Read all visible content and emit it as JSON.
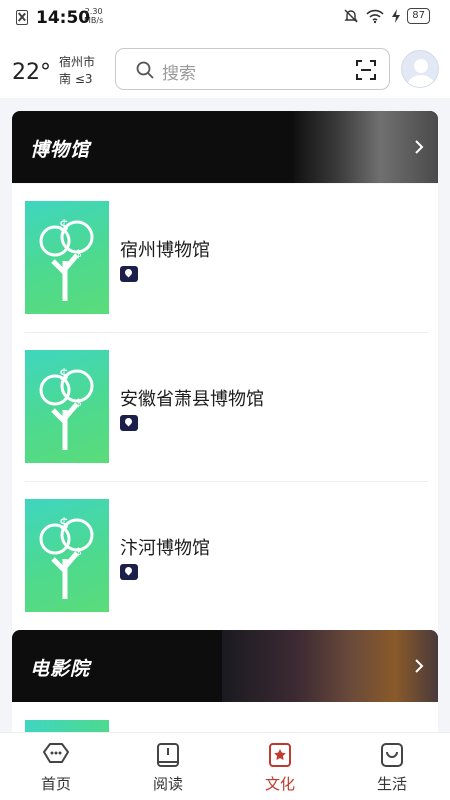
{
  "status_bar": {
    "time": "14:50",
    "speed_value": "2.30",
    "speed_unit": "MB/s",
    "battery": "87"
  },
  "header": {
    "temperature": "22°",
    "city": "宿州市",
    "wind": "南 ≤3",
    "search": {
      "placeholder": "搜索"
    }
  },
  "sections": [
    {
      "title": "博物馆",
      "items": [
        {
          "name": "宿州博物馆"
        },
        {
          "name": "安徽省萧县博物馆"
        },
        {
          "name": "汴河博物馆"
        }
      ]
    },
    {
      "title": "电影院"
    }
  ],
  "tabbar": {
    "tabs": [
      {
        "label": "首页",
        "icon": "home-icon"
      },
      {
        "label": "阅读",
        "icon": "book-icon"
      },
      {
        "label": "文化",
        "icon": "culture-star-icon"
      },
      {
        "label": "生活",
        "icon": "life-bag-icon"
      }
    ],
    "active_index": 2,
    "active_color": "#c0392b"
  }
}
